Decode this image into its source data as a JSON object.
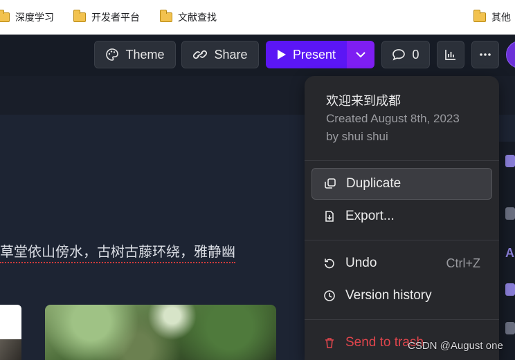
{
  "bookmarks": [
    {
      "label": "深度学习",
      "icon": "folder-icon"
    },
    {
      "label": "开发者平台",
      "icon": "folder-icon"
    },
    {
      "label": "文献查找",
      "icon": "folder-icon"
    },
    {
      "label": "其他",
      "icon": "folder-icon"
    }
  ],
  "toolbar": {
    "theme_label": "Theme",
    "share_label": "Share",
    "present_label": "Present",
    "comments_count": "0"
  },
  "document": {
    "body_text": "草堂依山傍水，古树古藤环绕，雅静幽"
  },
  "menu": {
    "title": "欢迎来到成都",
    "created": "Created August 8th, 2023",
    "author": "by shui shui",
    "items": [
      {
        "label": "Duplicate",
        "icon": "duplicate-icon",
        "shortcut": ""
      },
      {
        "label": "Export...",
        "icon": "export-icon",
        "shortcut": ""
      },
      {
        "label": "Undo",
        "icon": "undo-icon",
        "shortcut": "Ctrl+Z"
      },
      {
        "label": "Version history",
        "icon": "clock-icon",
        "shortcut": ""
      },
      {
        "label": "Send to trash",
        "icon": "trash-icon",
        "shortcut": ""
      }
    ]
  },
  "watermark": "CSDN @August one",
  "colors": {
    "accent": "#5b16f5",
    "accent_dropdown": "#7e1ef2",
    "danger": "#e0454c",
    "menu_bg": "#27282c"
  }
}
